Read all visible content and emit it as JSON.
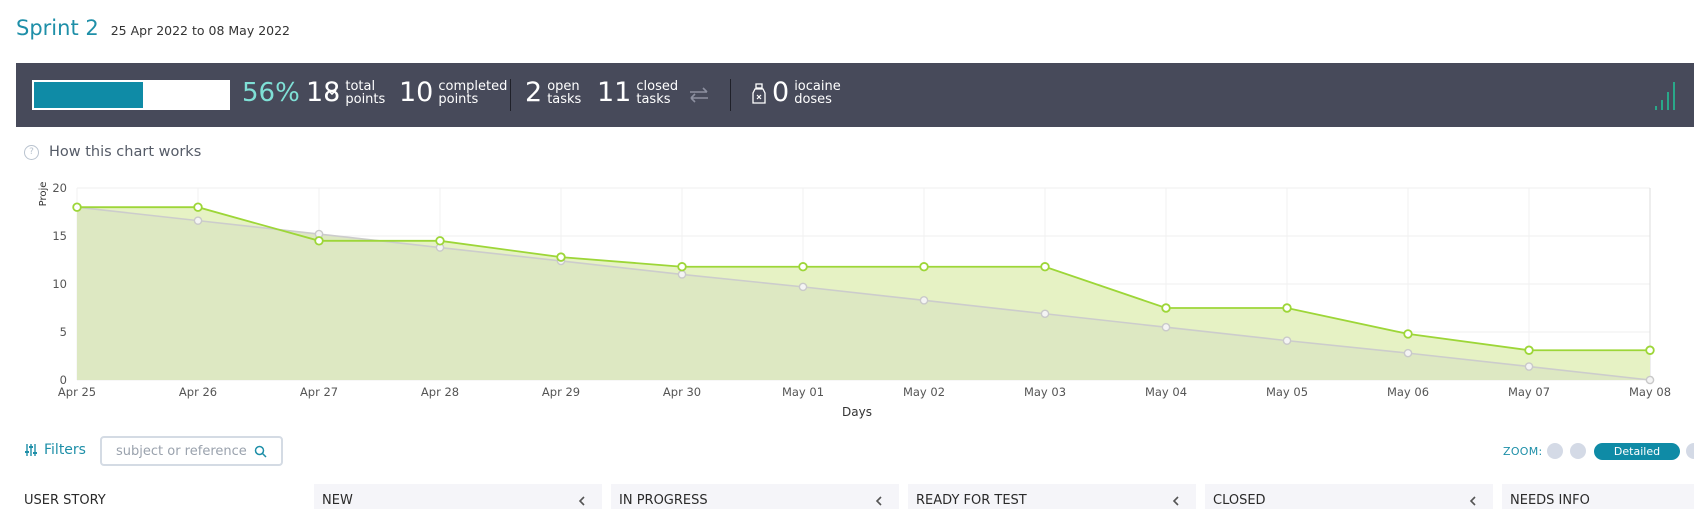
{
  "sprint": {
    "title": "Sprint 2",
    "dates": "25 Apr 2022 to 08 May 2022"
  },
  "stats": {
    "progress_percent": 56,
    "progress_label": "56%",
    "total_points": "18",
    "total_points_label": [
      "total",
      "points"
    ],
    "completed_points": "10",
    "completed_points_label": [
      "completed",
      "points"
    ],
    "open_tasks": "2",
    "open_tasks_label": [
      "open",
      "tasks"
    ],
    "closed_tasks": "11",
    "closed_tasks_label": [
      "closed",
      "tasks"
    ],
    "iocaine_doses": "0",
    "iocaine_label": [
      "iocaine",
      "doses"
    ]
  },
  "help_link": "How this chart works",
  "chart_data": {
    "type": "area",
    "x": [
      "Apr 25",
      "Apr 26",
      "Apr 27",
      "Apr 28",
      "Apr 29",
      "Apr 30",
      "May 01",
      "May 02",
      "May 03",
      "May 04",
      "May 05",
      "May 06",
      "May 07",
      "May 08"
    ],
    "xlabel": "Days",
    "ylabel": "Proje",
    "ylim": [
      0,
      20
    ],
    "yticks": [
      0,
      5,
      10,
      15,
      20
    ],
    "grid": true,
    "series": [
      {
        "role": "ideal",
        "color": "#cccccc",
        "values": [
          18,
          16.6,
          15.2,
          13.8,
          12.4,
          11.0,
          9.7,
          8.3,
          6.9,
          5.5,
          4.1,
          2.8,
          1.4,
          0
        ]
      },
      {
        "role": "actual",
        "color": "#9dd638",
        "values": [
          18,
          18,
          14.5,
          14.5,
          12.8,
          11.8,
          11.8,
          11.8,
          11.8,
          7.5,
          7.5,
          4.8,
          3.1,
          3.1
        ]
      }
    ]
  },
  "toolbar": {
    "filters_label": "Filters",
    "search_placeholder": "subject or reference",
    "zoom_label": "ZOOM:",
    "zoom_selected": "Detailed"
  },
  "columns": {
    "user_story": "USER STORY",
    "items": [
      "NEW",
      "IN PROGRESS",
      "READY FOR TEST",
      "CLOSED",
      "NEEDS INFO"
    ]
  },
  "colors": {
    "accent": "#1e8fa8",
    "stats_bg": "#474a5a",
    "progress_fill": "#0f8ba6",
    "percent_text": "#7fe0d6"
  }
}
